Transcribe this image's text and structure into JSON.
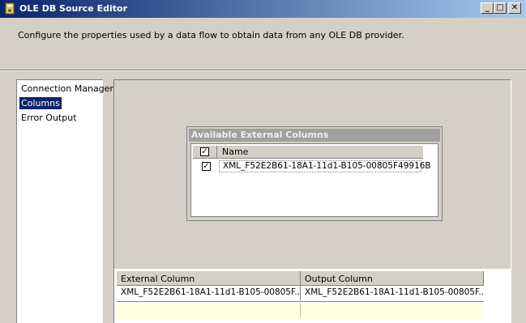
{
  "window": {
    "title": "OLE DB Source Editor",
    "controls": {
      "minimize": "_",
      "maximize": "□",
      "close": "✕"
    }
  },
  "header": {
    "description": "Configure the properties used by a data flow to obtain data from any OLE DB provider."
  },
  "nav": {
    "items": [
      {
        "label": "Connection Manager",
        "selected": false
      },
      {
        "label": "Columns",
        "selected": true
      },
      {
        "label": "Error Output",
        "selected": false
      }
    ]
  },
  "available_columns": {
    "title": "Available External Columns",
    "header": {
      "name": "Name",
      "checked": true
    },
    "rows": [
      {
        "name": "XML_F52E2B61-18A1-11d1-B105-00805F49916B",
        "checked": true
      }
    ]
  },
  "mapping_grid": {
    "headers": [
      "External Column",
      "Output Column"
    ],
    "rows": [
      {
        "external": "XML_F52E2B61-18A1-11d1-B105-00805F...",
        "output": "XML_F52E2B61-18A1-11d1-B105-00805F..."
      }
    ]
  },
  "colors": {
    "title_gradient_start": "#0a246a",
    "title_gradient_end": "#a6caf0",
    "selection": "#0a246a",
    "new_row": "#ffffe0",
    "chrome": "#d4d0c8"
  }
}
